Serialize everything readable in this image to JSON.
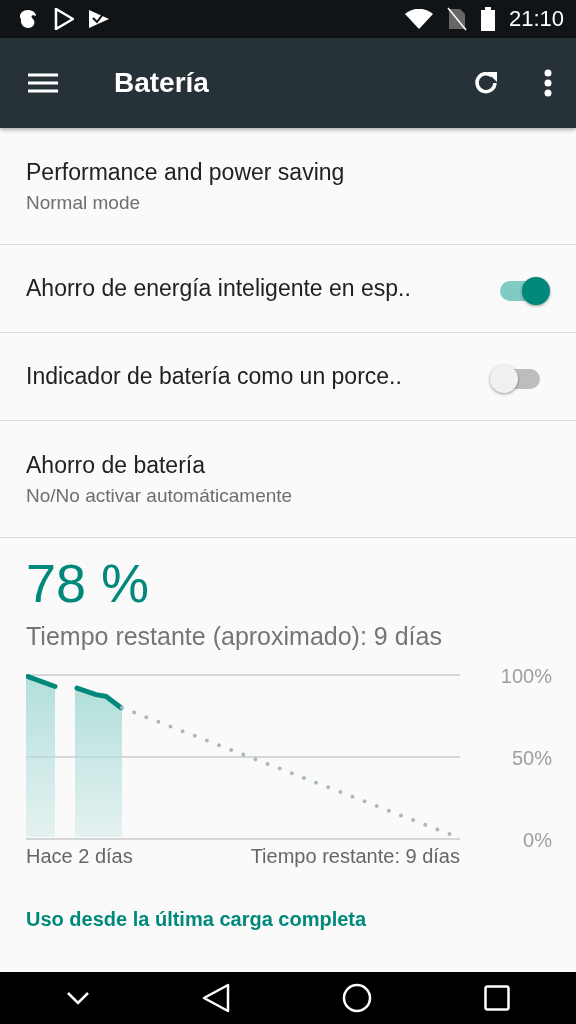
{
  "status_bar": {
    "time": "21:10"
  },
  "toolbar": {
    "title": "Batería"
  },
  "settings": [
    {
      "kind": "text",
      "title": "Performance and power saving",
      "summary": "Normal mode"
    },
    {
      "kind": "switch",
      "title": "Ahorro de energía inteligente en esp..",
      "on": true
    },
    {
      "kind": "switch",
      "title": "Indicador de batería como un porce..",
      "on": false
    },
    {
      "kind": "text",
      "title": "Ahorro de batería",
      "summary": "No/No activar automáticamente"
    }
  ],
  "battery": {
    "percent": "78 %",
    "remaining": "Tiempo restante (aproximado): 9 días",
    "graph_labels": [
      "100%",
      "50%",
      "0%"
    ],
    "start_label": "Hace 2 días",
    "end_label": "Tiempo restante: 9 días",
    "usage_link": "Uso desde la última carga completa"
  }
}
